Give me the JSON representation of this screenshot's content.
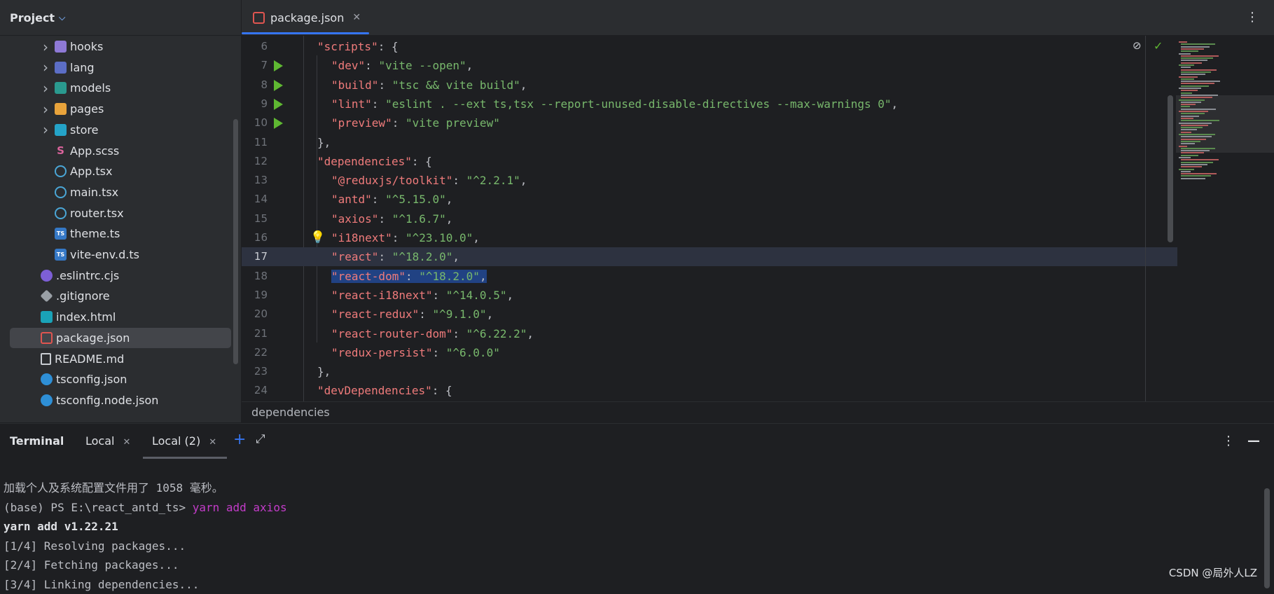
{
  "project_panel": {
    "title": "Project",
    "items": [
      {
        "label": "hooks",
        "icon": "folder-icon",
        "expandable": true
      },
      {
        "label": "lang",
        "icon": "folder-icon",
        "expandable": true
      },
      {
        "label": "models",
        "icon": "folder-icon",
        "expandable": true
      },
      {
        "label": "pages",
        "icon": "folder-icon",
        "expandable": true
      },
      {
        "label": "store",
        "icon": "folder-icon",
        "expandable": true
      },
      {
        "label": "App.scss",
        "icon": "scss-file-icon"
      },
      {
        "label": "App.tsx",
        "icon": "react-file-icon"
      },
      {
        "label": "main.tsx",
        "icon": "react-file-icon"
      },
      {
        "label": "router.tsx",
        "icon": "react-file-icon"
      },
      {
        "label": "theme.ts",
        "icon": "typescript-file-icon"
      },
      {
        "label": "vite-env.d.ts",
        "icon": "typescript-file-icon"
      },
      {
        "label": ".eslintrc.cjs",
        "icon": "eslint-file-icon"
      },
      {
        "label": ".gitignore",
        "icon": "git-file-icon"
      },
      {
        "label": "index.html",
        "icon": "html-file-icon"
      },
      {
        "label": "package.json",
        "icon": "package-json-icon",
        "selected": true
      },
      {
        "label": "README.md",
        "icon": "markdown-file-icon"
      },
      {
        "label": "tsconfig.json",
        "icon": "json-config-icon"
      },
      {
        "label": "tsconfig.node.json",
        "icon": "json-config-icon"
      }
    ]
  },
  "editor": {
    "tab_label": "package.json",
    "breadcrumb": "dependencies",
    "lines": [
      {
        "n": "6",
        "key": "\"scripts\"",
        "after": ": {",
        "indent": 1
      },
      {
        "n": "7",
        "key": "\"dev\"",
        "value": "\"vite --open\"",
        "comma": ",",
        "indent": 2,
        "run": true
      },
      {
        "n": "8",
        "key": "\"build\"",
        "value": "\"tsc && vite build\"",
        "comma": ",",
        "indent": 2,
        "run": true
      },
      {
        "n": "9",
        "key": "\"lint\"",
        "value": "\"eslint . --ext ts,tsx --report-unused-disable-directives --max-warnings 0\"",
        "comma": ",",
        "indent": 2,
        "run": true
      },
      {
        "n": "10",
        "key": "\"preview\"",
        "value": "\"vite preview\"",
        "comma": "",
        "indent": 2,
        "run": true
      },
      {
        "n": "11",
        "plain": "},",
        "indent": 1
      },
      {
        "n": "12",
        "key": "\"dependencies\"",
        "after": ": {",
        "indent": 1
      },
      {
        "n": "13",
        "key": "\"@reduxjs/toolkit\"",
        "value": "\"^2.2.1\"",
        "comma": ",",
        "indent": 2
      },
      {
        "n": "14",
        "key": "\"antd\"",
        "value": "\"^5.15.0\"",
        "comma": ",",
        "indent": 2
      },
      {
        "n": "15",
        "key": "\"axios\"",
        "value": "\"^1.6.7\"",
        "comma": ",",
        "indent": 2
      },
      {
        "n": "16",
        "key": "\"i18next\"",
        "value": "\"^23.10.0\"",
        "comma": ",",
        "indent": 2,
        "bulb": true
      },
      {
        "n": "17",
        "key": "\"react\"",
        "value": "\"^18.2.0\"",
        "comma": ",",
        "indent": 2,
        "current": true
      },
      {
        "n": "18",
        "key": "\"react-dom\"",
        "value": "\"^18.2.0\"",
        "comma": ",",
        "indent": 2,
        "selected": true
      },
      {
        "n": "19",
        "key": "\"react-i18next\"",
        "value": "\"^14.0.5\"",
        "comma": ",",
        "indent": 2
      },
      {
        "n": "20",
        "key": "\"react-redux\"",
        "value": "\"^9.1.0\"",
        "comma": ",",
        "indent": 2
      },
      {
        "n": "21",
        "key": "\"react-router-dom\"",
        "value": "\"^6.22.2\"",
        "comma": ",",
        "indent": 2
      },
      {
        "n": "22",
        "key": "\"redux-persist\"",
        "value": "\"^6.0.0\"",
        "comma": "",
        "indent": 2
      },
      {
        "n": "23",
        "plain": "},",
        "indent": 1
      },
      {
        "n": "24",
        "key": "\"devDependencies\"",
        "after": ": {",
        "indent": 1
      }
    ]
  },
  "terminal": {
    "title": "Terminal",
    "tabs": [
      {
        "label": "Local"
      },
      {
        "label": "Local (2)",
        "active": true
      }
    ],
    "lines": [
      {
        "text": "加载个人及系统配置文件用了 1058 毫秒。"
      },
      {
        "prompt": "(base) PS E:\\react_antd_ts> ",
        "cmd": "yarn add axios"
      },
      {
        "text": "yarn add v1.22.21",
        "bold": true
      },
      {
        "text": "[1/4] Resolving packages..."
      },
      {
        "text": "[2/4] Fetching packages..."
      },
      {
        "text": "[3/4] Linking dependencies..."
      }
    ]
  },
  "watermark": "CSDN @局外人LZ",
  "colors": {
    "accent": "#3574f0",
    "json_key": "#ef7b7b",
    "json_string": "#78b86c",
    "run_icon": "#5fb832",
    "terminal_command": "#c33cc9"
  }
}
